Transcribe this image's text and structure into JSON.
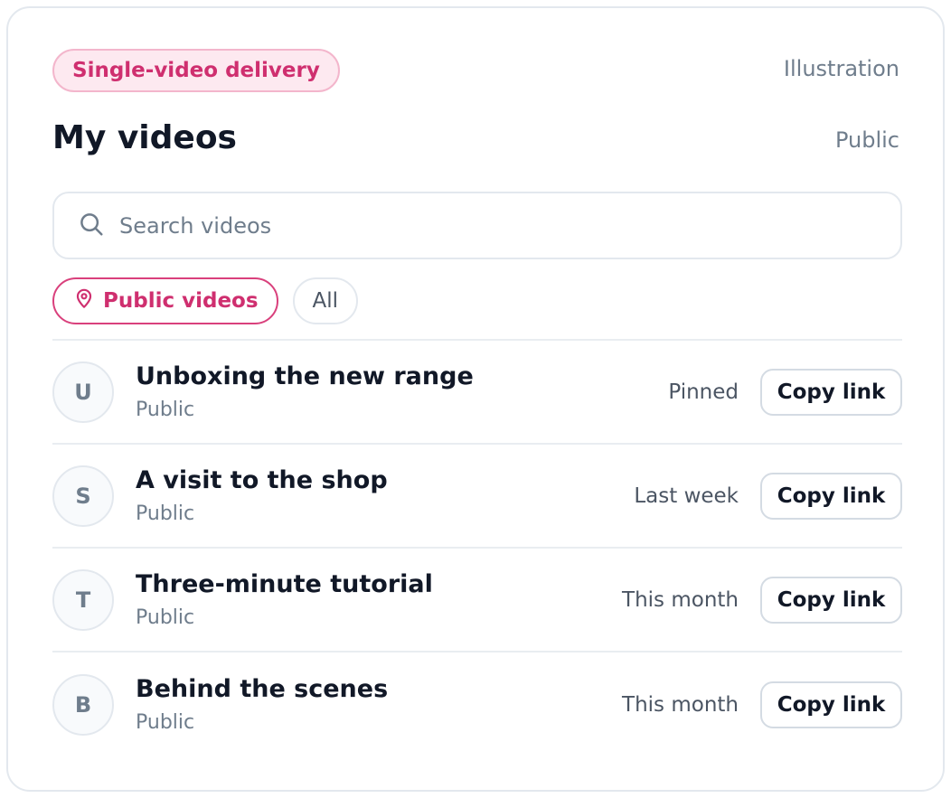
{
  "header": {
    "badge": "Single-video delivery",
    "corner_label": "Illustration",
    "title": "My videos",
    "visibility": "Public"
  },
  "search": {
    "placeholder": "Search videos",
    "value": ""
  },
  "filters": {
    "active_label": "Public videos",
    "active_icon": "location-pin-icon",
    "other_label": "All"
  },
  "videos": [
    {
      "initial": "U",
      "title": "Unboxing the new range",
      "visibility": "Public",
      "meta": "Pinned",
      "action": "Copy link"
    },
    {
      "initial": "S",
      "title": "A visit to the shop",
      "visibility": "Public",
      "meta": "Last week",
      "action": "Copy link"
    },
    {
      "initial": "T",
      "title": "Three-minute tutorial",
      "visibility": "Public",
      "meta": "This month",
      "action": "Copy link"
    },
    {
      "initial": "B",
      "title": "Behind the scenes",
      "visibility": "Public",
      "meta": "This month",
      "action": "Copy link"
    }
  ],
  "colors": {
    "accent": "#cf2f6f",
    "accent_bg": "#fde9f0",
    "text": "#111827",
    "muted": "#6f7d8c",
    "border": "#e3e8ee"
  }
}
